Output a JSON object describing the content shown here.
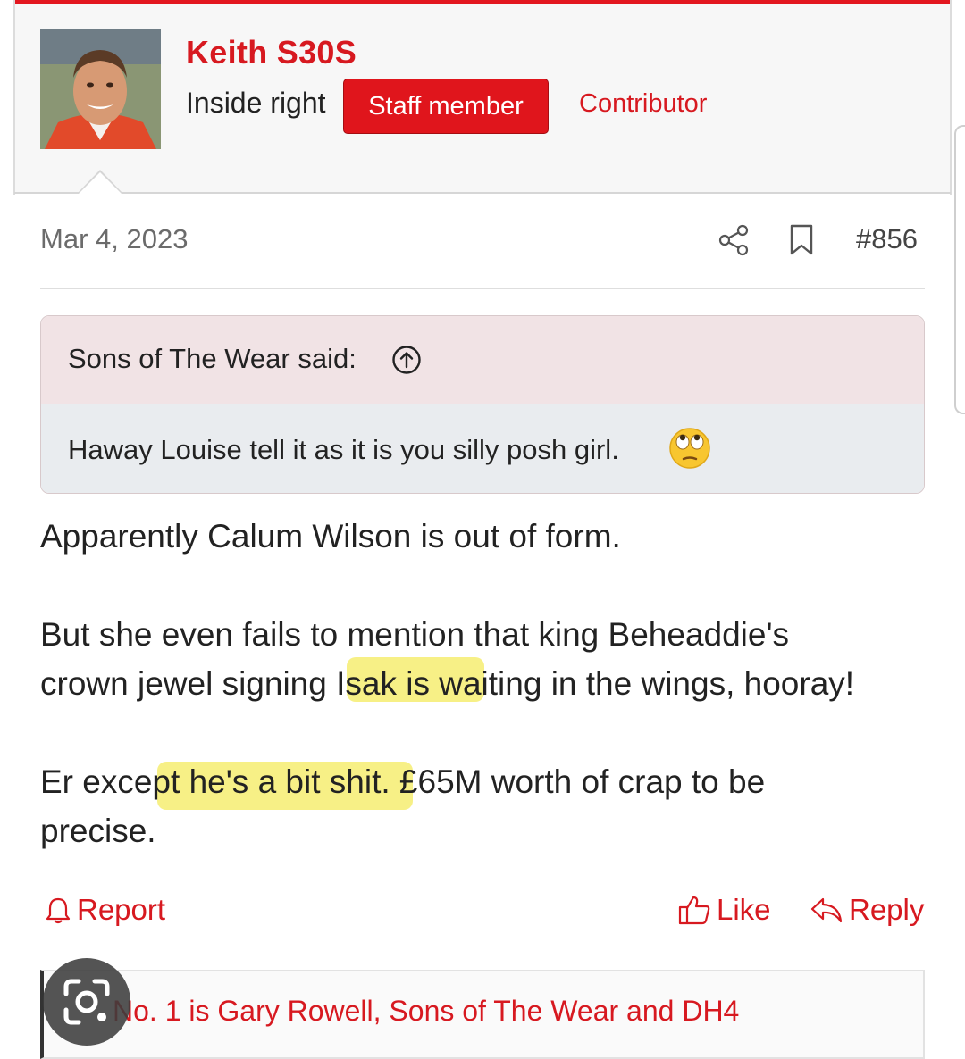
{
  "user": {
    "name": "Keith S30S",
    "title": "Inside right",
    "staff_badge": "Staff member",
    "role_banner": "Contributor"
  },
  "post": {
    "date": "Mar 4, 2023",
    "number": "#856",
    "quote": {
      "author": "Sons of The Wear said:",
      "text": "Haway Louise tell it as it is you silly posh girl."
    },
    "body": {
      "p1": "Apparently Calum Wilson is out of form.",
      "p2_line1": "But she even fails to mention that king Beheaddie's",
      "p2_line2": "crown jewel signing Isak is waiting in the wings, hooray!",
      "p3_line1": "Er except he's a bit shit. £65M worth of crap to be",
      "p3_line2": "precise."
    },
    "actions": {
      "report": "Report",
      "like": "Like",
      "reply": "Reply"
    },
    "signature": "No. 1 is Gary Rowell, Sons of The Wear and DH4"
  },
  "colors": {
    "accent": "#d71920",
    "highlight": "#f6ef7c",
    "quote_header": "#f1e3e5",
    "quote_body": "#e9ecef"
  },
  "icons": [
    "share-icon",
    "bookmark-icon",
    "arrow-up-circle-icon",
    "eye-roll-emoji",
    "bell-icon",
    "thumbs-up-icon",
    "reply-arrow-icon",
    "lens-icon"
  ]
}
